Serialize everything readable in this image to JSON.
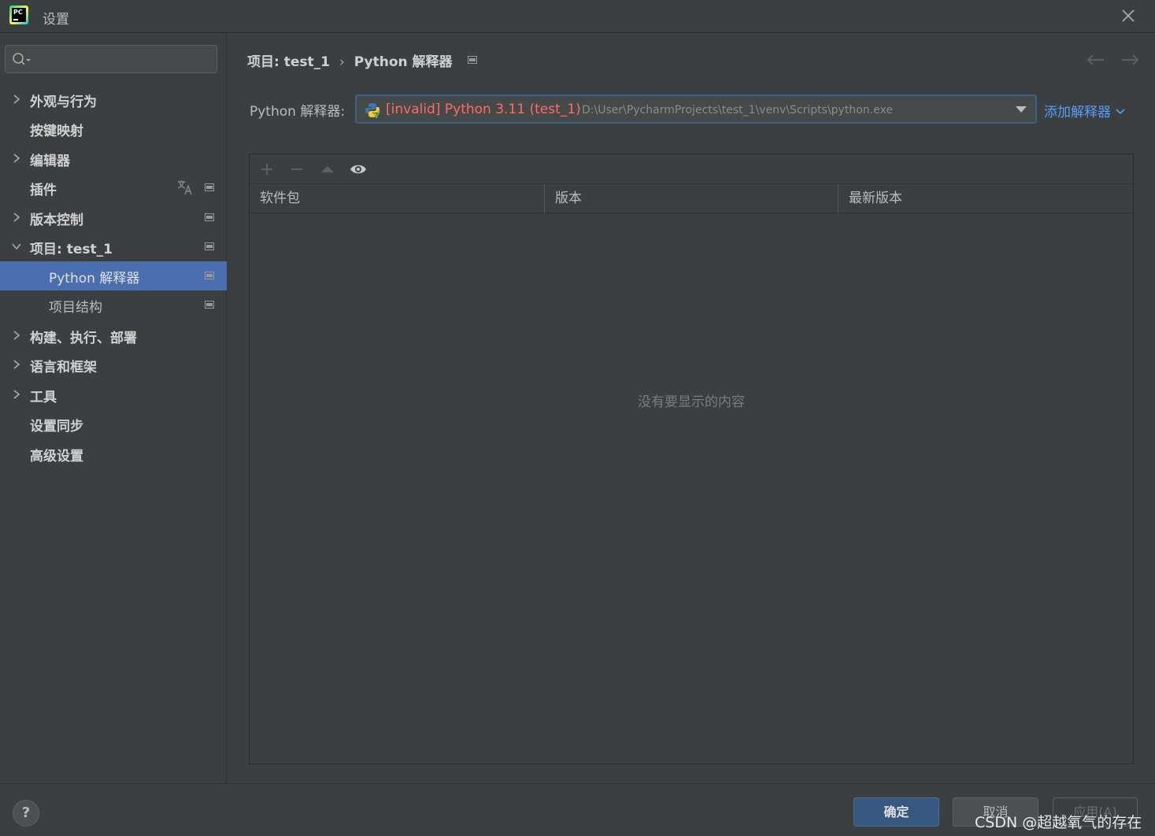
{
  "window": {
    "title": "设置"
  },
  "search": {
    "placeholder": ""
  },
  "sidebar": {
    "items": [
      {
        "label": "外观与行为"
      },
      {
        "label": "按键映射"
      },
      {
        "label": "编辑器"
      },
      {
        "label": "插件"
      },
      {
        "label": "版本控制"
      },
      {
        "label": "项目: test_1"
      },
      {
        "label": "Python 解释器"
      },
      {
        "label": "项目结构"
      },
      {
        "label": "构建、执行、部署"
      },
      {
        "label": "语言和框架"
      },
      {
        "label": "工具"
      },
      {
        "label": "设置同步"
      },
      {
        "label": "高级设置"
      }
    ]
  },
  "breadcrumb": {
    "project": "项目: test_1",
    "separator": "›",
    "page": "Python 解释器"
  },
  "interpreter": {
    "label": "Python 解释器:",
    "name": "[invalid] Python 3.11 (test_1)",
    "path": "D:\\User\\PycharmProjects\\test_1\\venv\\Scripts\\python.exe",
    "add_label": "添加解释器"
  },
  "packages": {
    "columns": [
      "软件包",
      "版本",
      "最新版本"
    ],
    "empty_text": "没有要显示的内容"
  },
  "footer": {
    "help": "?",
    "ok_label": "确定",
    "cancel_label": "取消",
    "apply_label": "应用(A)"
  },
  "watermark": "CSDN @超越氧气的存在",
  "colors": {
    "background": "#3c3f41",
    "selection": "#4b6eaf",
    "invalid": "#ff6b68",
    "link": "#589df6",
    "ok_button": "#365880"
  }
}
